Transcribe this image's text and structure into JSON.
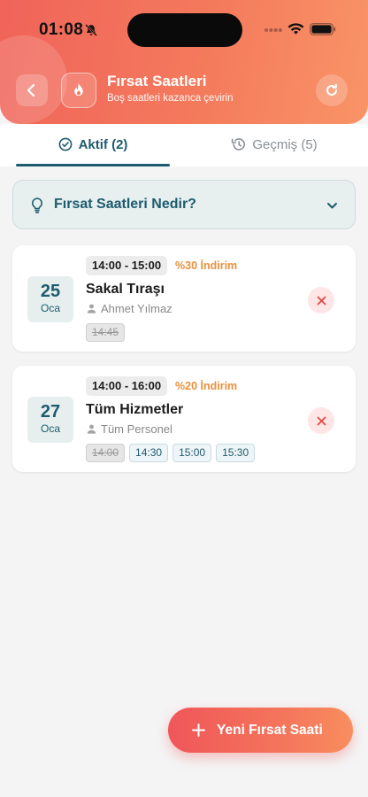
{
  "status_bar": {
    "time": "01:08",
    "icons": [
      "bell-slash-icon",
      "signal-dots-icon",
      "wifi-icon",
      "battery-icon"
    ]
  },
  "header": {
    "title": "Fırsat Saatleri",
    "subtitle": "Boş saatleri kazanca çevirin",
    "icons": [
      "back-arrow-icon",
      "flame-icon",
      "refresh-icon"
    ],
    "gradient": [
      "#f0645a",
      "#f99467"
    ]
  },
  "tabs": [
    {
      "label": "Aktif (2)",
      "icon": "check-circle-icon",
      "active": true
    },
    {
      "label": "Geçmiş (5)",
      "icon": "history-icon",
      "active": false
    }
  ],
  "info": {
    "title": "Fırsat Saatleri Nedir?",
    "icon": "lightbulb-icon",
    "expanded": false
  },
  "opportunities": [
    {
      "day": "25",
      "month": "Oca",
      "time_range": "14:00 - 15:00",
      "discount": "%30 İndirim",
      "service": "Sakal Tıraşı",
      "staff": "Ahmet Yılmaz",
      "slots": [
        {
          "time": "14:45",
          "booked": true
        }
      ]
    },
    {
      "day": "27",
      "month": "Oca",
      "time_range": "14:00 - 16:00",
      "discount": "%20 İndirim",
      "service": "Tüm Hizmetler",
      "staff": "Tüm Personel",
      "slots": [
        {
          "time": "14:00",
          "booked": true
        },
        {
          "time": "14:30",
          "booked": false
        },
        {
          "time": "15:00",
          "booked": false
        },
        {
          "time": "15:30",
          "booked": false
        }
      ]
    }
  ],
  "fab": {
    "label": "Yeni Fırsat Saati",
    "icon": "plus-icon"
  },
  "colors": {
    "primary": "#1d5b6e",
    "accent": "#f0645a",
    "discount": "#e8903d",
    "delete": "#e04848"
  }
}
